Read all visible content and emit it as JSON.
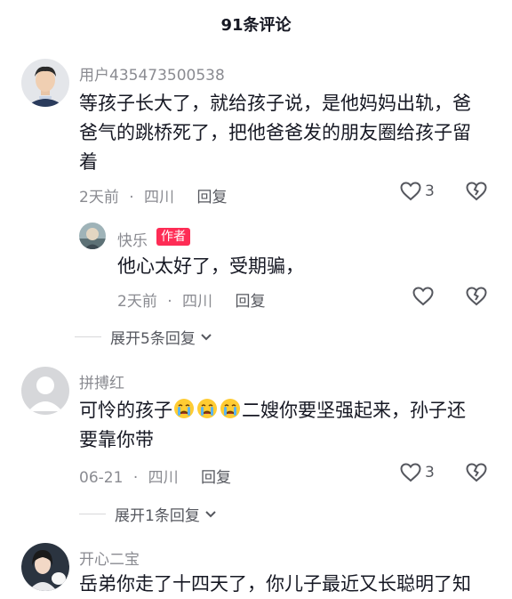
{
  "header": {
    "title": "91条评论"
  },
  "comments": [
    {
      "username": "用户435473500538",
      "lines": [
        "等孩子长大了，就给孩子说，是他妈妈出轨，爸",
        "爸气的跳桥死了，把他爸爸发的朋友圈给孩子留",
        "着"
      ],
      "time": "2天前",
      "location": "四川",
      "reply_label": "回复",
      "likes": "3",
      "reply": {
        "username": "快乐",
        "author_tag": "作者",
        "text": "他心太好了，受期骗，",
        "time": "2天前",
        "location": "四川",
        "reply_label": "回复"
      },
      "expand_label": "展开5条回复"
    },
    {
      "username": "拼搏红",
      "line1_before": "可怜的孩子",
      "line1_after": "二嫂你要坚强起来，孙子还",
      "line2": "要靠你带",
      "emoji_icons": [
        "crying-face-icon",
        "crying-face-icon",
        "crying-face-icon"
      ],
      "time": "06-21",
      "location": "四川",
      "reply_label": "回复",
      "likes": "3",
      "expand_label": "展开1条回复"
    },
    {
      "username": "开心二宝",
      "text_partial": "岳弟你走了十四天了，你儿子最近又长聪明了知"
    }
  ],
  "separator": "·"
}
